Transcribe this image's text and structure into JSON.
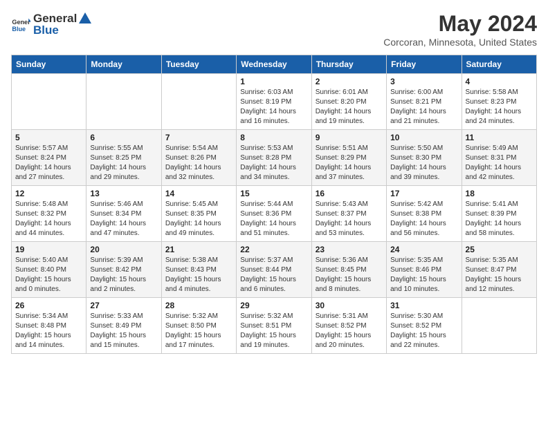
{
  "header": {
    "logo_general": "General",
    "logo_blue": "Blue",
    "month_year": "May 2024",
    "location": "Corcoran, Minnesota, United States"
  },
  "days_of_week": [
    "Sunday",
    "Monday",
    "Tuesday",
    "Wednesday",
    "Thursday",
    "Friday",
    "Saturday"
  ],
  "weeks": [
    [
      {
        "day": "",
        "info": ""
      },
      {
        "day": "",
        "info": ""
      },
      {
        "day": "",
        "info": ""
      },
      {
        "day": "1",
        "info": "Sunrise: 6:03 AM\nSunset: 8:19 PM\nDaylight: 14 hours and 16 minutes."
      },
      {
        "day": "2",
        "info": "Sunrise: 6:01 AM\nSunset: 8:20 PM\nDaylight: 14 hours and 19 minutes."
      },
      {
        "day": "3",
        "info": "Sunrise: 6:00 AM\nSunset: 8:21 PM\nDaylight: 14 hours and 21 minutes."
      },
      {
        "day": "4",
        "info": "Sunrise: 5:58 AM\nSunset: 8:23 PM\nDaylight: 14 hours and 24 minutes."
      }
    ],
    [
      {
        "day": "5",
        "info": "Sunrise: 5:57 AM\nSunset: 8:24 PM\nDaylight: 14 hours and 27 minutes."
      },
      {
        "day": "6",
        "info": "Sunrise: 5:55 AM\nSunset: 8:25 PM\nDaylight: 14 hours and 29 minutes."
      },
      {
        "day": "7",
        "info": "Sunrise: 5:54 AM\nSunset: 8:26 PM\nDaylight: 14 hours and 32 minutes."
      },
      {
        "day": "8",
        "info": "Sunrise: 5:53 AM\nSunset: 8:28 PM\nDaylight: 14 hours and 34 minutes."
      },
      {
        "day": "9",
        "info": "Sunrise: 5:51 AM\nSunset: 8:29 PM\nDaylight: 14 hours and 37 minutes."
      },
      {
        "day": "10",
        "info": "Sunrise: 5:50 AM\nSunset: 8:30 PM\nDaylight: 14 hours and 39 minutes."
      },
      {
        "day": "11",
        "info": "Sunrise: 5:49 AM\nSunset: 8:31 PM\nDaylight: 14 hours and 42 minutes."
      }
    ],
    [
      {
        "day": "12",
        "info": "Sunrise: 5:48 AM\nSunset: 8:32 PM\nDaylight: 14 hours and 44 minutes."
      },
      {
        "day": "13",
        "info": "Sunrise: 5:46 AM\nSunset: 8:34 PM\nDaylight: 14 hours and 47 minutes."
      },
      {
        "day": "14",
        "info": "Sunrise: 5:45 AM\nSunset: 8:35 PM\nDaylight: 14 hours and 49 minutes."
      },
      {
        "day": "15",
        "info": "Sunrise: 5:44 AM\nSunset: 8:36 PM\nDaylight: 14 hours and 51 minutes."
      },
      {
        "day": "16",
        "info": "Sunrise: 5:43 AM\nSunset: 8:37 PM\nDaylight: 14 hours and 53 minutes."
      },
      {
        "day": "17",
        "info": "Sunrise: 5:42 AM\nSunset: 8:38 PM\nDaylight: 14 hours and 56 minutes."
      },
      {
        "day": "18",
        "info": "Sunrise: 5:41 AM\nSunset: 8:39 PM\nDaylight: 14 hours and 58 minutes."
      }
    ],
    [
      {
        "day": "19",
        "info": "Sunrise: 5:40 AM\nSunset: 8:40 PM\nDaylight: 15 hours and 0 minutes."
      },
      {
        "day": "20",
        "info": "Sunrise: 5:39 AM\nSunset: 8:42 PM\nDaylight: 15 hours and 2 minutes."
      },
      {
        "day": "21",
        "info": "Sunrise: 5:38 AM\nSunset: 8:43 PM\nDaylight: 15 hours and 4 minutes."
      },
      {
        "day": "22",
        "info": "Sunrise: 5:37 AM\nSunset: 8:44 PM\nDaylight: 15 hours and 6 minutes."
      },
      {
        "day": "23",
        "info": "Sunrise: 5:36 AM\nSunset: 8:45 PM\nDaylight: 15 hours and 8 minutes."
      },
      {
        "day": "24",
        "info": "Sunrise: 5:35 AM\nSunset: 8:46 PM\nDaylight: 15 hours and 10 minutes."
      },
      {
        "day": "25",
        "info": "Sunrise: 5:35 AM\nSunset: 8:47 PM\nDaylight: 15 hours and 12 minutes."
      }
    ],
    [
      {
        "day": "26",
        "info": "Sunrise: 5:34 AM\nSunset: 8:48 PM\nDaylight: 15 hours and 14 minutes."
      },
      {
        "day": "27",
        "info": "Sunrise: 5:33 AM\nSunset: 8:49 PM\nDaylight: 15 hours and 15 minutes."
      },
      {
        "day": "28",
        "info": "Sunrise: 5:32 AM\nSunset: 8:50 PM\nDaylight: 15 hours and 17 minutes."
      },
      {
        "day": "29",
        "info": "Sunrise: 5:32 AM\nSunset: 8:51 PM\nDaylight: 15 hours and 19 minutes."
      },
      {
        "day": "30",
        "info": "Sunrise: 5:31 AM\nSunset: 8:52 PM\nDaylight: 15 hours and 20 minutes."
      },
      {
        "day": "31",
        "info": "Sunrise: 5:30 AM\nSunset: 8:52 PM\nDaylight: 15 hours and 22 minutes."
      },
      {
        "day": "",
        "info": ""
      }
    ]
  ]
}
